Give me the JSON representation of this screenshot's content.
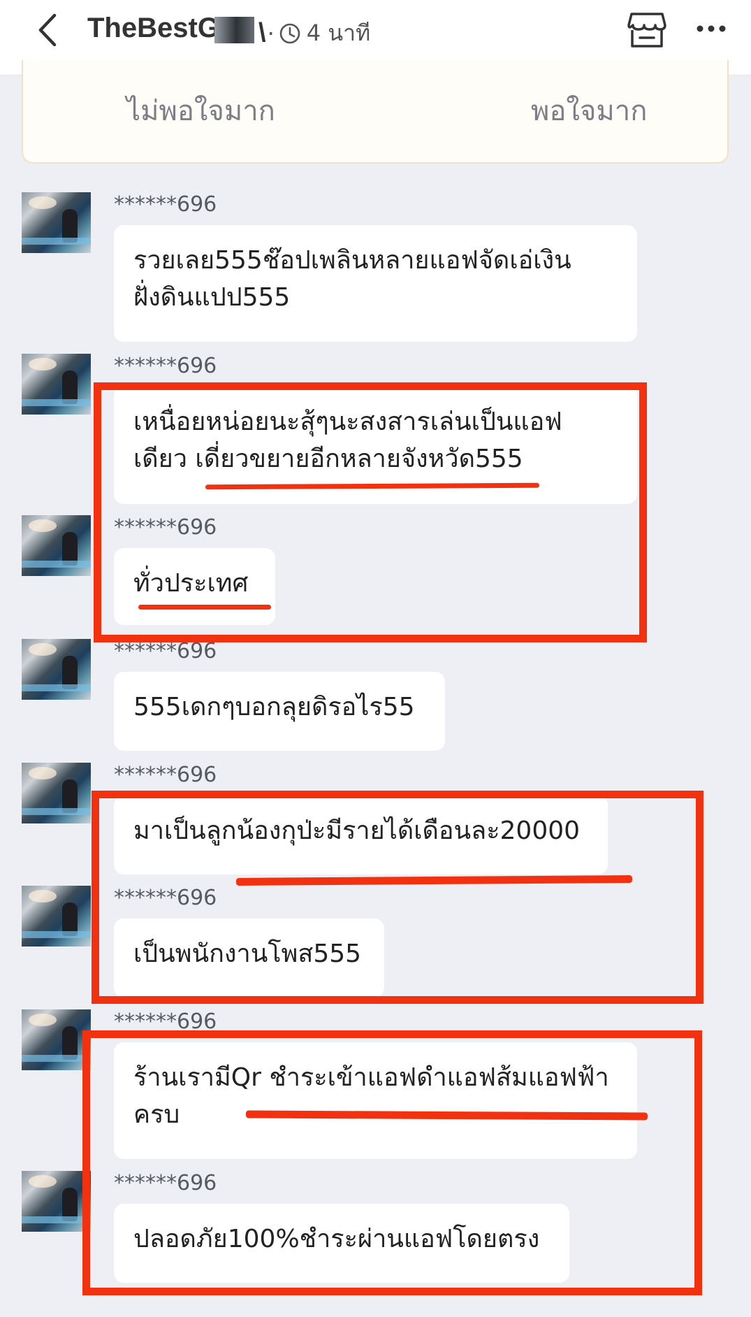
{
  "header": {
    "title": "TheBestG",
    "title_tail": "\\",
    "separator": "·",
    "time": "4 นาที",
    "icons": [
      "back-icon",
      "clock-icon",
      "shop-icon",
      "more-icon"
    ]
  },
  "rating": {
    "low_label": "ไม่พอใจมาก",
    "high_label": "พอใจมาก"
  },
  "messages": [
    {
      "name": "******696",
      "lines": [
        "รวยเลย555ช๊อปเพลินหลายแอฟจัดเอ่เงิน",
        "ฝั่งดินแปป555"
      ]
    },
    {
      "name": "******696",
      "lines": [
        "เหนื่อยหน่อยนะสุ้ๆนะสงสารเล่นเป็นแอฟ",
        "เดียว เดี่ยวขยายอีกหลายจังหวัด555"
      ]
    },
    {
      "name": "******696",
      "lines": [
        "ทั่วประเทศ"
      ]
    },
    {
      "name": "******696",
      "lines": [
        "555เดกๆบอกลุยดิรอไร55"
      ]
    },
    {
      "name": "******696",
      "lines": [
        "มาเป็นลูกน้องกุป่ะมีรายได้เดือนละ20000"
      ]
    },
    {
      "name": "******696",
      "lines": [
        "เป็นพนักงานโพส555"
      ]
    },
    {
      "name": "******696",
      "lines": [
        "ร้านเรามีQr ชำระเข้าแอฟดำแอฟส้มแอฟฟ้า",
        "ครบ"
      ]
    },
    {
      "name": "******696",
      "lines": [
        "ปลอดภัย100%ชำระผ่านแอฟโดยตรง"
      ]
    }
  ],
  "colors": {
    "background": "#eeeff5",
    "bubble": "#ffffff",
    "annotation_red": "#f1310f",
    "rating_card": "#fffdf7"
  }
}
